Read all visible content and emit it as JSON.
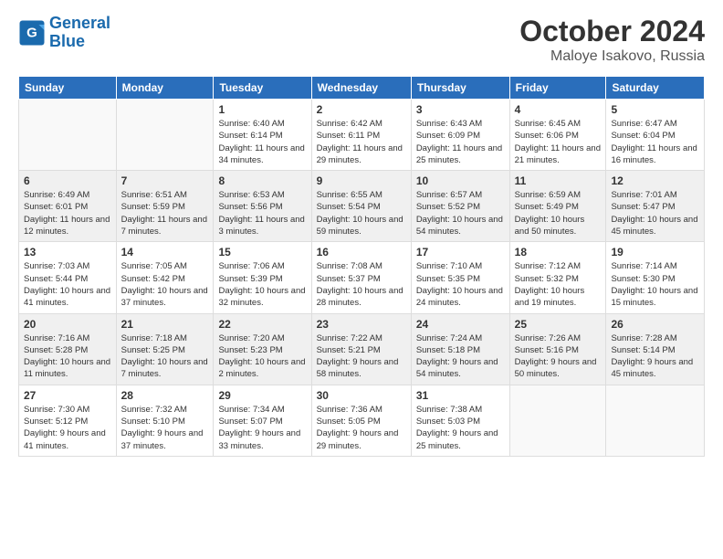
{
  "header": {
    "logo_line1": "General",
    "logo_line2": "Blue",
    "month_title": "October 2024",
    "location": "Maloye Isakovo, Russia"
  },
  "weekdays": [
    "Sunday",
    "Monday",
    "Tuesday",
    "Wednesday",
    "Thursday",
    "Friday",
    "Saturday"
  ],
  "weeks": [
    [
      {
        "day": "",
        "info": ""
      },
      {
        "day": "",
        "info": ""
      },
      {
        "day": "1",
        "info": "Sunrise: 6:40 AM\nSunset: 6:14 PM\nDaylight: 11 hours and 34 minutes."
      },
      {
        "day": "2",
        "info": "Sunrise: 6:42 AM\nSunset: 6:11 PM\nDaylight: 11 hours and 29 minutes."
      },
      {
        "day": "3",
        "info": "Sunrise: 6:43 AM\nSunset: 6:09 PM\nDaylight: 11 hours and 25 minutes."
      },
      {
        "day": "4",
        "info": "Sunrise: 6:45 AM\nSunset: 6:06 PM\nDaylight: 11 hours and 21 minutes."
      },
      {
        "day": "5",
        "info": "Sunrise: 6:47 AM\nSunset: 6:04 PM\nDaylight: 11 hours and 16 minutes."
      }
    ],
    [
      {
        "day": "6",
        "info": "Sunrise: 6:49 AM\nSunset: 6:01 PM\nDaylight: 11 hours and 12 minutes."
      },
      {
        "day": "7",
        "info": "Sunrise: 6:51 AM\nSunset: 5:59 PM\nDaylight: 11 hours and 7 minutes."
      },
      {
        "day": "8",
        "info": "Sunrise: 6:53 AM\nSunset: 5:56 PM\nDaylight: 11 hours and 3 minutes."
      },
      {
        "day": "9",
        "info": "Sunrise: 6:55 AM\nSunset: 5:54 PM\nDaylight: 10 hours and 59 minutes."
      },
      {
        "day": "10",
        "info": "Sunrise: 6:57 AM\nSunset: 5:52 PM\nDaylight: 10 hours and 54 minutes."
      },
      {
        "day": "11",
        "info": "Sunrise: 6:59 AM\nSunset: 5:49 PM\nDaylight: 10 hours and 50 minutes."
      },
      {
        "day": "12",
        "info": "Sunrise: 7:01 AM\nSunset: 5:47 PM\nDaylight: 10 hours and 45 minutes."
      }
    ],
    [
      {
        "day": "13",
        "info": "Sunrise: 7:03 AM\nSunset: 5:44 PM\nDaylight: 10 hours and 41 minutes."
      },
      {
        "day": "14",
        "info": "Sunrise: 7:05 AM\nSunset: 5:42 PM\nDaylight: 10 hours and 37 minutes."
      },
      {
        "day": "15",
        "info": "Sunrise: 7:06 AM\nSunset: 5:39 PM\nDaylight: 10 hours and 32 minutes."
      },
      {
        "day": "16",
        "info": "Sunrise: 7:08 AM\nSunset: 5:37 PM\nDaylight: 10 hours and 28 minutes."
      },
      {
        "day": "17",
        "info": "Sunrise: 7:10 AM\nSunset: 5:35 PM\nDaylight: 10 hours and 24 minutes."
      },
      {
        "day": "18",
        "info": "Sunrise: 7:12 AM\nSunset: 5:32 PM\nDaylight: 10 hours and 19 minutes."
      },
      {
        "day": "19",
        "info": "Sunrise: 7:14 AM\nSunset: 5:30 PM\nDaylight: 10 hours and 15 minutes."
      }
    ],
    [
      {
        "day": "20",
        "info": "Sunrise: 7:16 AM\nSunset: 5:28 PM\nDaylight: 10 hours and 11 minutes."
      },
      {
        "day": "21",
        "info": "Sunrise: 7:18 AM\nSunset: 5:25 PM\nDaylight: 10 hours and 7 minutes."
      },
      {
        "day": "22",
        "info": "Sunrise: 7:20 AM\nSunset: 5:23 PM\nDaylight: 10 hours and 2 minutes."
      },
      {
        "day": "23",
        "info": "Sunrise: 7:22 AM\nSunset: 5:21 PM\nDaylight: 9 hours and 58 minutes."
      },
      {
        "day": "24",
        "info": "Sunrise: 7:24 AM\nSunset: 5:18 PM\nDaylight: 9 hours and 54 minutes."
      },
      {
        "day": "25",
        "info": "Sunrise: 7:26 AM\nSunset: 5:16 PM\nDaylight: 9 hours and 50 minutes."
      },
      {
        "day": "26",
        "info": "Sunrise: 7:28 AM\nSunset: 5:14 PM\nDaylight: 9 hours and 45 minutes."
      }
    ],
    [
      {
        "day": "27",
        "info": "Sunrise: 7:30 AM\nSunset: 5:12 PM\nDaylight: 9 hours and 41 minutes."
      },
      {
        "day": "28",
        "info": "Sunrise: 7:32 AM\nSunset: 5:10 PM\nDaylight: 9 hours and 37 minutes."
      },
      {
        "day": "29",
        "info": "Sunrise: 7:34 AM\nSunset: 5:07 PM\nDaylight: 9 hours and 33 minutes."
      },
      {
        "day": "30",
        "info": "Sunrise: 7:36 AM\nSunset: 5:05 PM\nDaylight: 9 hours and 29 minutes."
      },
      {
        "day": "31",
        "info": "Sunrise: 7:38 AM\nSunset: 5:03 PM\nDaylight: 9 hours and 25 minutes."
      },
      {
        "day": "",
        "info": ""
      },
      {
        "day": "",
        "info": ""
      }
    ]
  ]
}
